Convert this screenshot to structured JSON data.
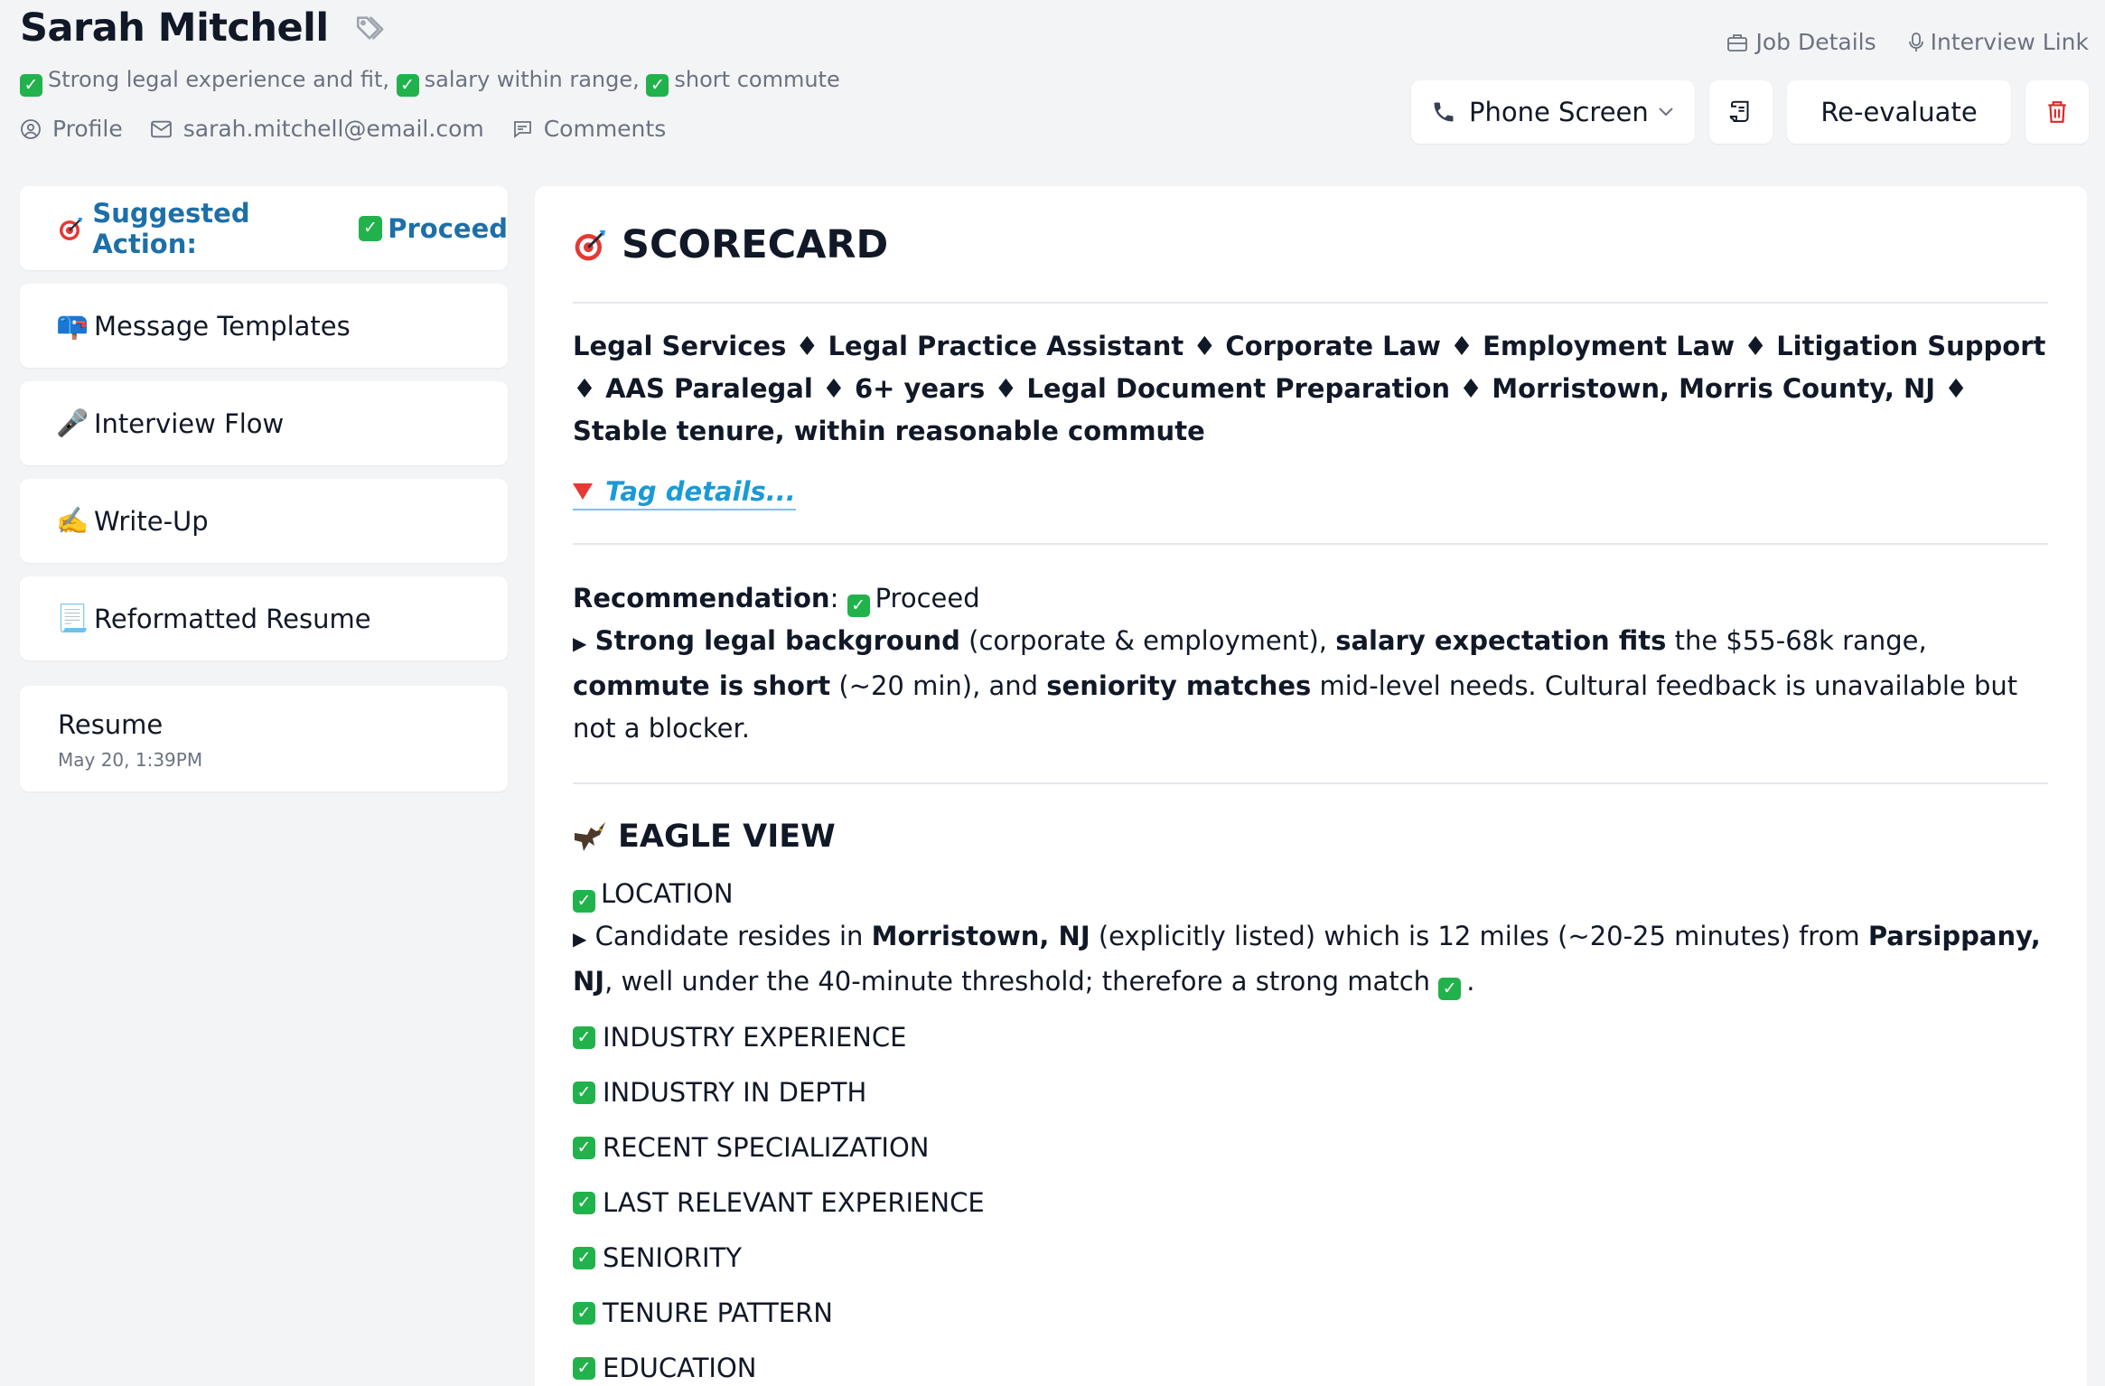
{
  "candidate": {
    "name": "Sarah Mitchell",
    "summary": [
      "Strong legal experience and fit,",
      "salary within range,",
      "short commute"
    ],
    "profile_label": "Profile",
    "email": "sarah.mitchell@email.com",
    "comments_label": "Comments"
  },
  "top_links": {
    "job_details": "Job Details",
    "interview_link": "Interview Link"
  },
  "actions": {
    "stage_value": "Phone Screen",
    "reevaluate_label": "Re-evaluate"
  },
  "sidebar": {
    "suggested_label": "Suggested Action:",
    "suggested_value": "Proceed",
    "items": [
      {
        "emoji": "📪",
        "label": "Message Templates"
      },
      {
        "emoji": "🎤",
        "label": "Interview Flow"
      },
      {
        "emoji": "✍️",
        "label": "Write-Up"
      },
      {
        "emoji": "📃",
        "label": "Reformatted Resume"
      }
    ],
    "resume": {
      "title": "Resume",
      "date": "May 20, 1:39PM"
    }
  },
  "scorecard": {
    "title": "SCORECARD",
    "tags": "Legal Services ♦ Legal Practice Assistant ♦ Corporate Law ♦ Employment Law ♦ Litigation Support ♦ AAS Paralegal ♦ 6+ years ♦ Legal Document Preparation ♦ Morristown, Morris County, NJ ♦ Stable tenure, within reasonable commute",
    "tag_details": "Tag details...",
    "recommendation": {
      "label": "Recommendation",
      "value": "Proceed",
      "bullet_parts": {
        "p1": "Strong legal background",
        "p2": " (corporate & employment), ",
        "p3": "salary expectation fits",
        "p4": " the $55-68k range, ",
        "p5": "commute is short",
        "p6": " (~20 min), and ",
        "p7": "seniority matches",
        "p8": " mid-level needs. Cultural feedback is unavailable but not a blocker."
      }
    }
  },
  "eagle_view": {
    "title": "EAGLE VIEW",
    "location": {
      "label": "LOCATION",
      "p1": "Candidate resides in ",
      "p2": "Morristown, NJ",
      "p3": " (explicitly listed) which is 12 miles (~20-25 minutes) from ",
      "p4": "Parsippany, NJ",
      "p5": ", well under the 40-minute threshold; therefore a strong match "
    },
    "items": [
      "INDUSTRY EXPERIENCE",
      "INDUSTRY IN DEPTH",
      "RECENT SPECIALIZATION",
      "LAST RELEVANT EXPERIENCE",
      "SENIORITY",
      "TENURE PATTERN",
      "EDUCATION"
    ]
  },
  "colors": {
    "accent_blue": "#1e6fa8",
    "link_blue": "#1a9ad6",
    "check_green": "#22b24c",
    "delete_red": "#dc2626"
  }
}
